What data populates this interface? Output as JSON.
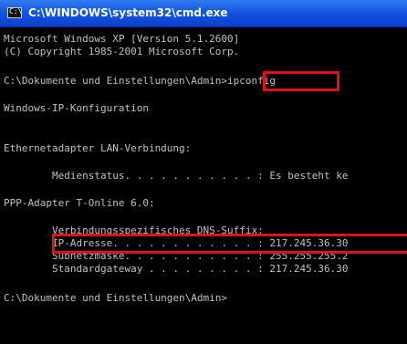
{
  "window": {
    "title": "C:\\WINDOWS\\system32\\cmd.exe",
    "icon": "cmd-icon"
  },
  "console": {
    "lines": [
      "Microsoft Windows XP [Version 5.1.2600]",
      "(C) Copyright 1985-2001 Microsoft Corp.",
      "C:\\Dokumente und Einstellungen\\Admin>ipconfig",
      "Windows-IP-Konfiguration",
      "Ethernetadapter LAN-Verbindung:",
      "        Medienstatus. . . . . . . . . . . : Es besteht ke",
      "PPP-Adapter T-Online 6.0:",
      "        Verbindungsspezifisches DNS-Suffix:",
      "        IP-Adresse. . . . . . . . . . . . : 217.245.36.30",
      "        Subnetzmaske. . . . . . . . . . . : 255.255.255.2",
      "        Standardgateway . . . . . . . . . : 217.245.36.30",
      "C:\\Dokumente und Einstellungen\\Admin>"
    ]
  },
  "highlight_color": "#e01313",
  "text_color": "#c0c0c0"
}
